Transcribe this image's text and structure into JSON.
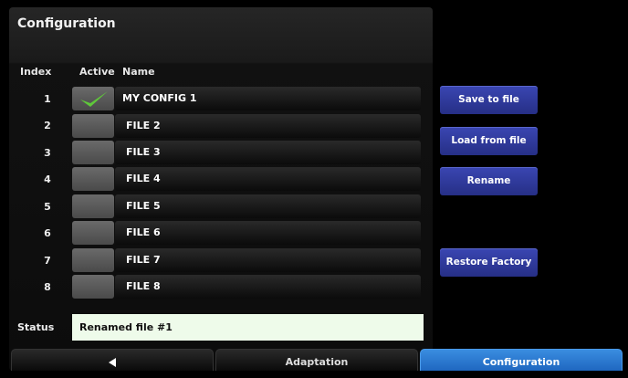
{
  "header": {
    "title": "Configuration"
  },
  "table": {
    "columns": {
      "index": "Index",
      "active": "Active",
      "name": "Name"
    },
    "rows": [
      {
        "index": "1",
        "active": true,
        "name": "MY CONFIG 1"
      },
      {
        "index": "2",
        "active": false,
        "name": "FILE 2"
      },
      {
        "index": "3",
        "active": false,
        "name": "FILE 3"
      },
      {
        "index": "4",
        "active": false,
        "name": "FILE 4"
      },
      {
        "index": "5",
        "active": false,
        "name": "FILE 5"
      },
      {
        "index": "6",
        "active": false,
        "name": "FILE 6"
      },
      {
        "index": "7",
        "active": false,
        "name": "FILE 7"
      },
      {
        "index": "8",
        "active": false,
        "name": "FILE 8"
      }
    ]
  },
  "actions": {
    "save": "Save to file",
    "load": "Load from file",
    "rename": "Rename",
    "restore": "Restore Factory"
  },
  "status": {
    "label": "Status",
    "value": "Renamed file #1"
  },
  "tabs": {
    "back_icon": "back-arrow-icon",
    "adaptation": "Adaptation",
    "configuration": "Configuration"
  },
  "colors": {
    "button": "#2e38a0",
    "active_tab": "#2a7ad6",
    "status_bg": "#eefbea",
    "check": "#5fc83a"
  }
}
